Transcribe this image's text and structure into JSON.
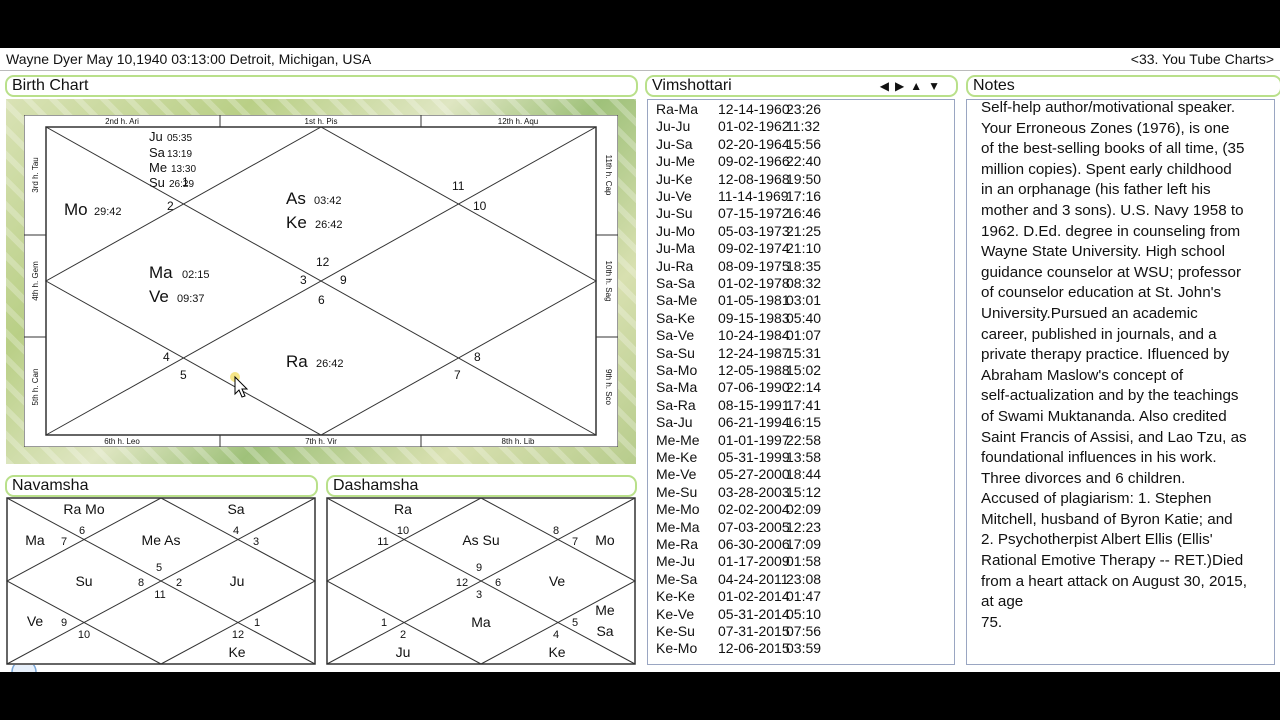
{
  "header": {
    "title": "Wayne Dyer  May 10,1940 03:13:00   Detroit, Michigan, USA",
    "right": "<33. You Tube Charts>"
  },
  "birth_chart": {
    "label": "Birth Chart",
    "houses_outer": {
      "top": [
        "2nd h.  Ari",
        "1st h.  Pis",
        "12th h.  Aqu"
      ],
      "bottom": [
        "6th h.  Leo",
        "7th h.  Vir",
        "8th h.  Lib"
      ],
      "left": [
        "3rd h.  Tau",
        "4th h.  Gem",
        "5th h.  Can"
      ],
      "right": [
        "11th h.  Cap",
        "10th h.  Sag",
        "9th h.  Sco"
      ]
    },
    "sign_numbers": [
      "2",
      "1",
      "11",
      "10",
      "12",
      "3",
      "9",
      "6",
      "4",
      "5",
      "8",
      "7"
    ],
    "planets": {
      "ju": "Ju",
      "ju_deg": "05:35",
      "sa": "Sa",
      "sa_deg": "13:19",
      "me": "Me",
      "me_deg": "13:30",
      "su": "Su",
      "su_deg": "26:29",
      "mo": "Mo",
      "mo_deg": "29:42",
      "as": "As",
      "as_deg": "03:42",
      "ke": "Ke",
      "ke_deg": "26:42",
      "ma": "Ma",
      "ma_deg": "02:15",
      "ve": "Ve",
      "ve_deg": "09:37",
      "ra": "Ra",
      "ra_deg": "26:42"
    }
  },
  "navamsha": {
    "label": "Navamsha",
    "planets": [
      "Ra Mo",
      "Sa",
      "Ma",
      "Me As",
      "Su",
      "Ju",
      "Ve",
      "Ke"
    ],
    "numbers": [
      "6",
      "4",
      "7",
      "3",
      "5",
      "8",
      "2",
      "11",
      "9",
      "10",
      "12",
      "1"
    ]
  },
  "dashamsha": {
    "label": "Dashamsha",
    "planets": [
      "Ra",
      "As Su",
      "Mo",
      "Ve",
      "Me",
      "Sa",
      "Ju",
      "Ma",
      "Ke"
    ],
    "numbers": [
      "10",
      "8",
      "11",
      "7",
      "9",
      "12",
      "6",
      "3",
      "1",
      "2",
      "5",
      "4"
    ]
  },
  "vimshottari": {
    "label": "Vimshottari",
    "nav_icons": [
      "arrow-left-icon",
      "arrow-right-icon",
      "arrow-up-icon",
      "arrow-down-icon"
    ],
    "rows": [
      [
        "Ra-Ma",
        "12-14-1960",
        "23:26"
      ],
      [
        "Ju-Ju",
        "01-02-1962",
        "11:32"
      ],
      [
        "Ju-Sa",
        "02-20-1964",
        "15:56"
      ],
      [
        "Ju-Me",
        "09-02-1966",
        "22:40"
      ],
      [
        "Ju-Ke",
        "12-08-1968",
        "19:50"
      ],
      [
        "Ju-Ve",
        "11-14-1969",
        "17:16"
      ],
      [
        "Ju-Su",
        "07-15-1972",
        "16:46"
      ],
      [
        "Ju-Mo",
        "05-03-1973",
        "21:25"
      ],
      [
        "Ju-Ma",
        "09-02-1974",
        "21:10"
      ],
      [
        "Ju-Ra",
        "08-09-1975",
        "18:35"
      ],
      [
        "Sa-Sa",
        "01-02-1978",
        "08:32"
      ],
      [
        "Sa-Me",
        "01-05-1981",
        "03:01"
      ],
      [
        "Sa-Ke",
        "09-15-1983",
        "05:40"
      ],
      [
        "Sa-Ve",
        "10-24-1984",
        "01:07"
      ],
      [
        "Sa-Su",
        "12-24-1987",
        "15:31"
      ],
      [
        "Sa-Mo",
        "12-05-1988",
        "15:02"
      ],
      [
        "Sa-Ma",
        "07-06-1990",
        "22:14"
      ],
      [
        "Sa-Ra",
        "08-15-1991",
        "17:41"
      ],
      [
        "Sa-Ju",
        "06-21-1994",
        "16:15"
      ],
      [
        "Me-Me",
        "01-01-1997",
        "22:58"
      ],
      [
        "Me-Ke",
        "05-31-1999",
        "13:58"
      ],
      [
        "Me-Ve",
        "05-27-2000",
        "18:44"
      ],
      [
        "Me-Su",
        "03-28-2003",
        "15:12"
      ],
      [
        "Me-Mo",
        "02-02-2004",
        "02:09"
      ],
      [
        "Me-Ma",
        "07-03-2005",
        "12:23"
      ],
      [
        "Me-Ra",
        "06-30-2006",
        "17:09"
      ],
      [
        "Me-Ju",
        "01-17-2009",
        "01:58"
      ],
      [
        "Me-Sa",
        "04-24-2011",
        "23:08"
      ],
      [
        "Ke-Ke",
        "01-02-2014",
        "01:47"
      ],
      [
        "Ke-Ve",
        "05-31-2014",
        "05:10"
      ],
      [
        "Ke-Su",
        "07-31-2015",
        "07:56"
      ],
      [
        "Ke-Mo",
        "12-06-2015",
        "03:59"
      ]
    ]
  },
  "notes": {
    "label": "Notes",
    "lines": [
      "Self-help author/motivational speaker.",
      "Your Erroneous Zones (1976), is one",
      "of the best-selling books of all time, (35",
      "million copies).  Spent early childhood",
      "in an orphanage (his father left his",
      "mother and 3 sons).  U.S. Navy 1958 to",
      "1962. D.Ed. degree in counseling from",
      "Wayne State University. High school",
      "guidance counselor at WSU; professor",
      "of counselor education at St. John's",
      "University.Pursued an academic",
      "career, published in journals, and a",
      "private therapy practice. Ifluenced by",
      "Abraham Maslow's concept of",
      "self-actualization and by the teachings",
      "of Swami Muktananda. Also credited",
      "Saint Francis of Assisi, and Lao Tzu, as",
      "foundational influences in his work.",
      "Three divorces and 6 children.",
      "Accused of plagiarism: 1. Stephen",
      "Mitchell, husband of Byron Katie; and",
      "2. Psychotherpist Albert Ellis (Ellis'",
      "Rational Emotive Therapy -- RET.)Died",
      "from a heart attack on August 30, 2015,",
      "at age",
      "75."
    ]
  }
}
